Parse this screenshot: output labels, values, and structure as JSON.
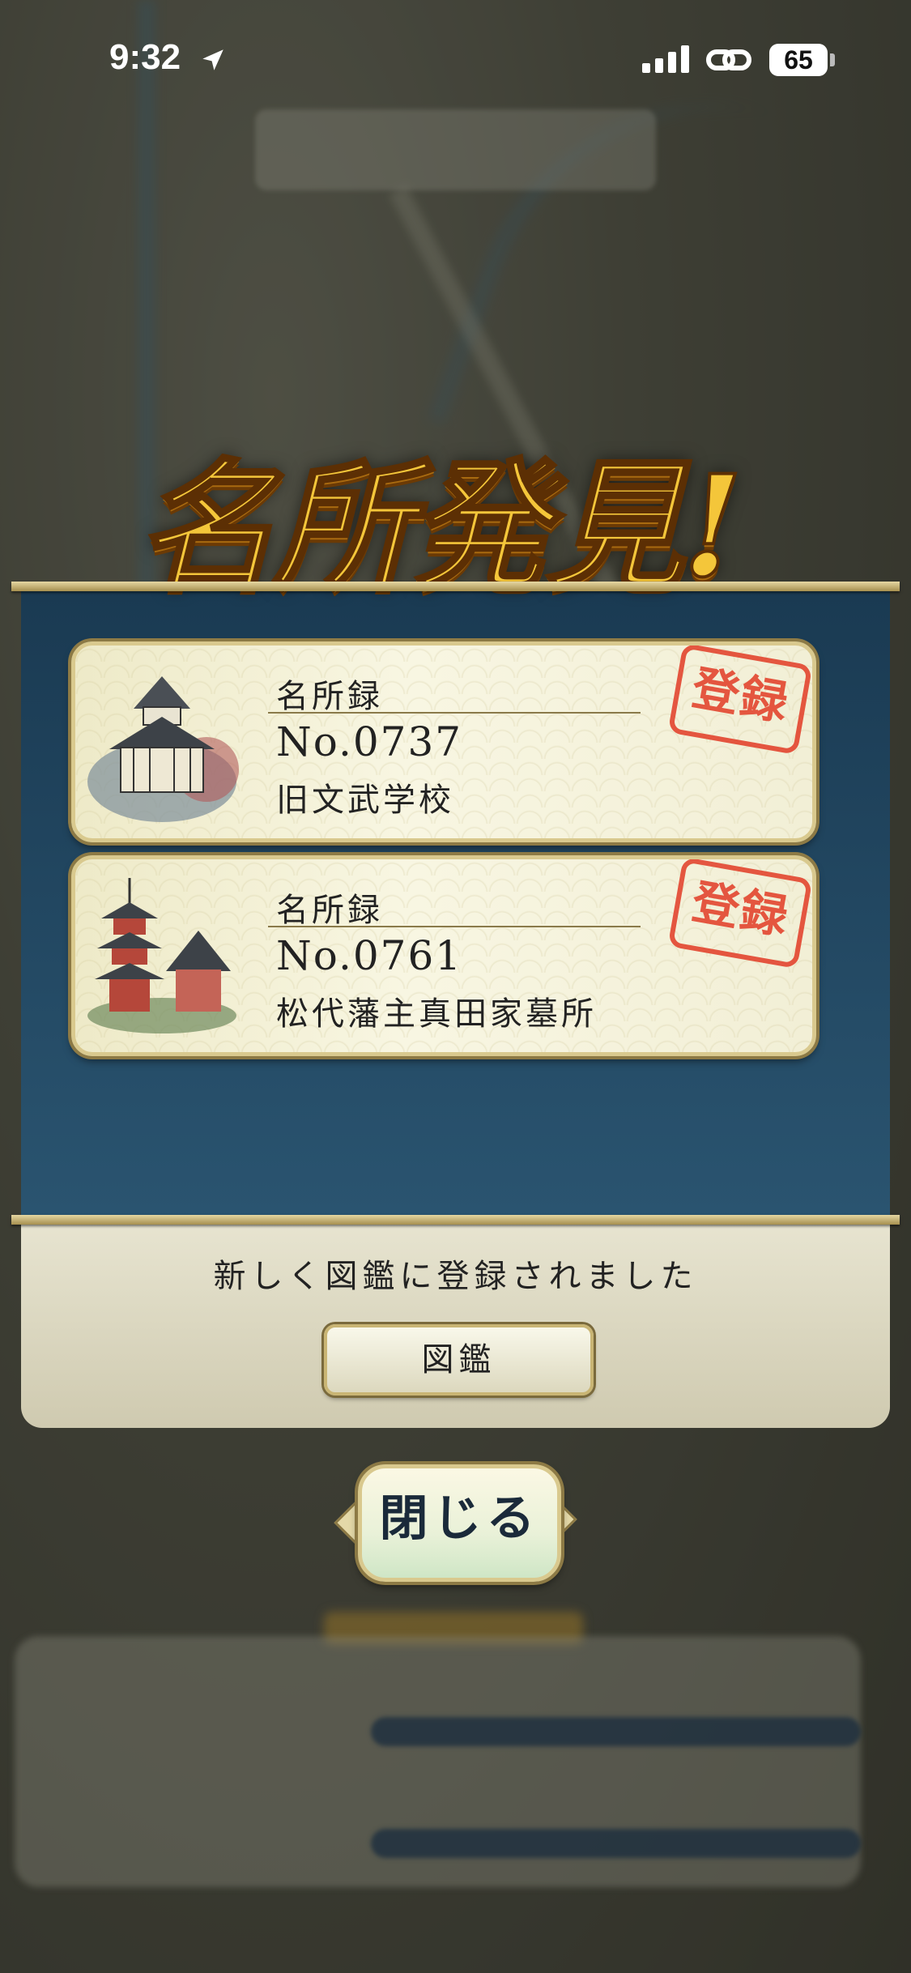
{
  "status_bar": {
    "time": "9:32",
    "battery": "65",
    "icons": [
      "location-arrow-icon",
      "signal-icon",
      "link-icon",
      "battery-icon"
    ]
  },
  "dialog": {
    "title": "名所発見!",
    "cards": [
      {
        "category": "名所録",
        "number": "No.0737",
        "name": "旧文武学校",
        "stamp": "登録",
        "illustration": "school-building-illustration"
      },
      {
        "category": "名所録",
        "number": "No.0761",
        "name": "松代藩主真田家墓所",
        "stamp": "登録",
        "illustration": "pagoda-shrine-illustration"
      }
    ],
    "message": "新しく図鑑に登録されました",
    "zukan_button": "図鑑",
    "close_button": "閉じる"
  },
  "colors": {
    "panel_blue": "#1a3a52",
    "stamp_red": "#e3452f",
    "title_gold": "#f4c63a"
  }
}
